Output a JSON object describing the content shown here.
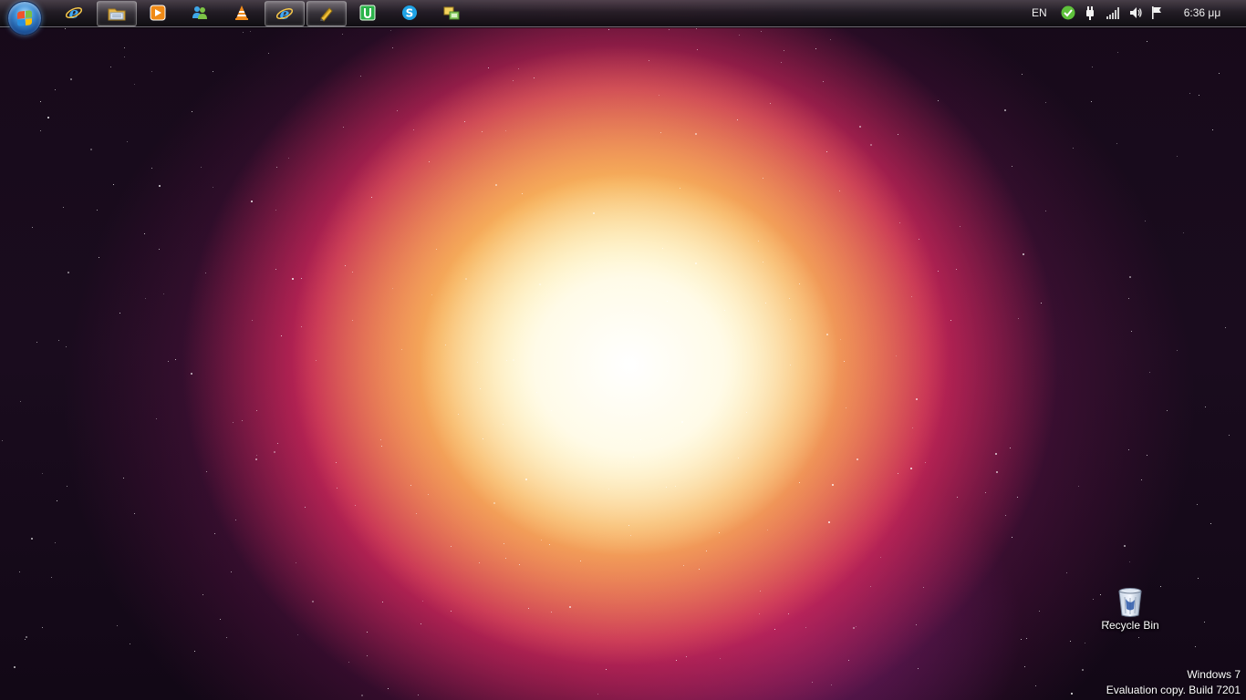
{
  "taskbar": {
    "start_button": {
      "icon": "windows-logo-icon"
    },
    "pinned": [
      {
        "name": "internet-explorer",
        "icon": "ie-icon",
        "active": false
      },
      {
        "name": "windows-explorer",
        "icon": "folder-icon",
        "active": true
      },
      {
        "name": "media-player",
        "icon": "media-player-icon",
        "active": false
      },
      {
        "name": "messenger",
        "icon": "messenger-icon",
        "active": false
      },
      {
        "name": "vlc",
        "icon": "vlc-cone-icon",
        "active": false
      },
      {
        "name": "internet-explorer-2",
        "icon": "ie-icon",
        "active": true
      },
      {
        "name": "notes",
        "icon": "pencil-icon",
        "active": true
      },
      {
        "name": "utorrent",
        "icon": "utorrent-icon",
        "active": false
      },
      {
        "name": "skype",
        "icon": "skype-icon",
        "active": false
      },
      {
        "name": "remote-desktop",
        "icon": "remote-desktop-icon",
        "active": false
      }
    ]
  },
  "tray": {
    "language": "EN",
    "icons": [
      "security-check-icon",
      "power-plug-icon",
      "signal-bars-icon",
      "volume-icon",
      "action-center-flag-icon"
    ],
    "clock": "6:36 μμ"
  },
  "desktop": {
    "icons": [
      {
        "label": "Recycle Bin",
        "icon": "recycle-bin-icon"
      }
    ]
  },
  "watermark": {
    "line1": "Windows 7",
    "line2": "Evaluation copy. Build 7201"
  },
  "colors": {
    "taskbar": "#1e1a20",
    "orb_blue": "#3f8fd6",
    "text": "#ffffff"
  }
}
